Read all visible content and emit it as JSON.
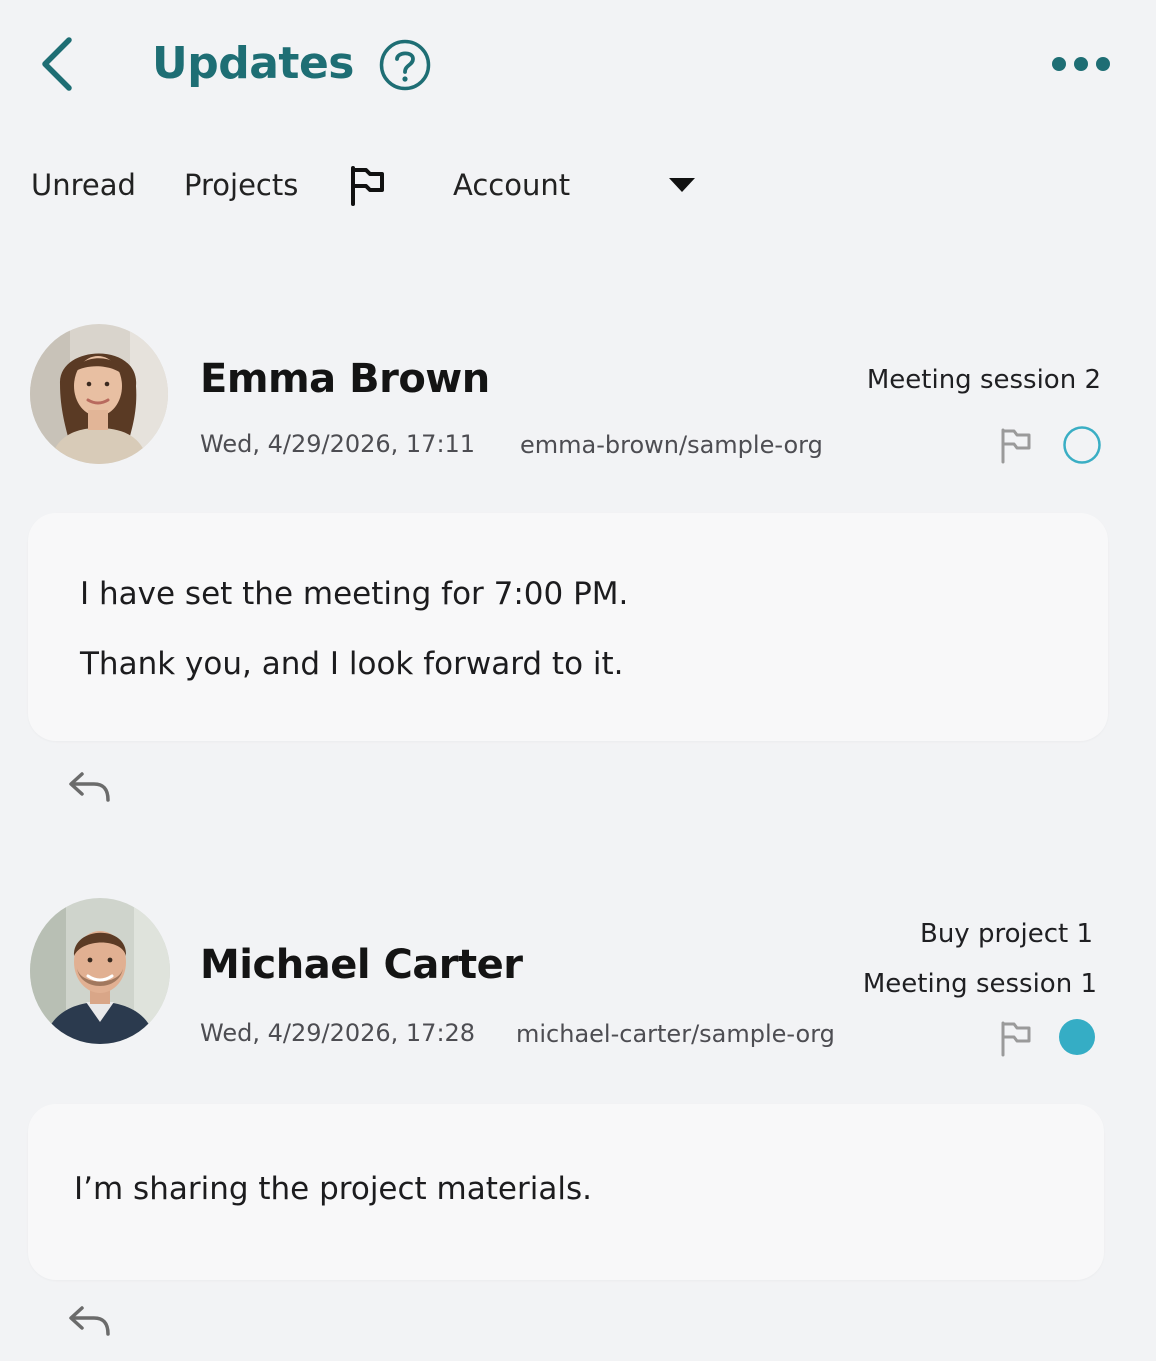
{
  "header": {
    "title": "Updates",
    "accent_color": "#1e6e74"
  },
  "filters": {
    "unread_label": "Unread",
    "projects_label": "Projects",
    "account_label": "Account"
  },
  "messages": [
    {
      "sender": "Emma Brown",
      "timestamp": "Wed, 4/29/2026, 17:11",
      "org": "emma-brown/sample-org",
      "tags": [
        "Meeting session 2"
      ],
      "status": "unread-outline",
      "body_lines": [
        "I have set the meeting for 7:00 PM.",
        "Thank you, and I look forward to it."
      ]
    },
    {
      "sender": "Michael Carter",
      "timestamp": "Wed, 4/29/2026, 17:28",
      "org": "michael-carter/sample-org",
      "tags": [
        "Buy project 1",
        "Meeting session 1"
      ],
      "status": "filled",
      "body_lines": [
        "I’m sharing the project materials."
      ]
    }
  ],
  "colors": {
    "status_outline": "#3aaec4",
    "status_filled": "#35adc5",
    "icon_gray": "#9a9a9a"
  },
  "icons": {
    "back": "chevron-left-icon",
    "help": "help-circle-icon",
    "more": "more-horizontal-icon",
    "flag": "flag-icon",
    "caret": "caret-down-icon",
    "reply": "reply-icon"
  }
}
